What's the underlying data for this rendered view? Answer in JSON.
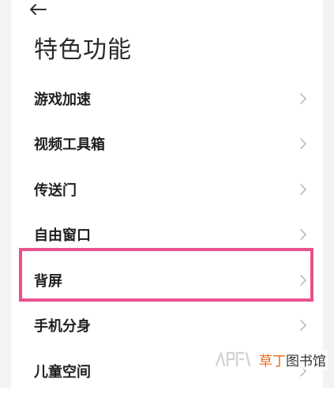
{
  "header": {
    "back_icon": "arrow-left-icon",
    "title": "特色功能"
  },
  "list": {
    "items": [
      {
        "label": "游戏加速",
        "icon": "chevron-right-icon"
      },
      {
        "label": "视频工具箱",
        "icon": "chevron-right-icon"
      },
      {
        "label": "传送门",
        "icon": "chevron-right-icon"
      },
      {
        "label": "自由窗口",
        "icon": "chevron-right-icon"
      },
      {
        "label": "背屏",
        "icon": "chevron-right-icon",
        "highlighted": true
      },
      {
        "label": "手机分身",
        "icon": "chevron-right-icon"
      },
      {
        "label": "儿童空间",
        "icon": "chevron-right-icon"
      }
    ]
  },
  "highlight": {
    "color": "#e8528c"
  },
  "watermark": {
    "accent_text": "草丁",
    "rest_text": "图书馆",
    "accent_color": "#e8681c"
  }
}
